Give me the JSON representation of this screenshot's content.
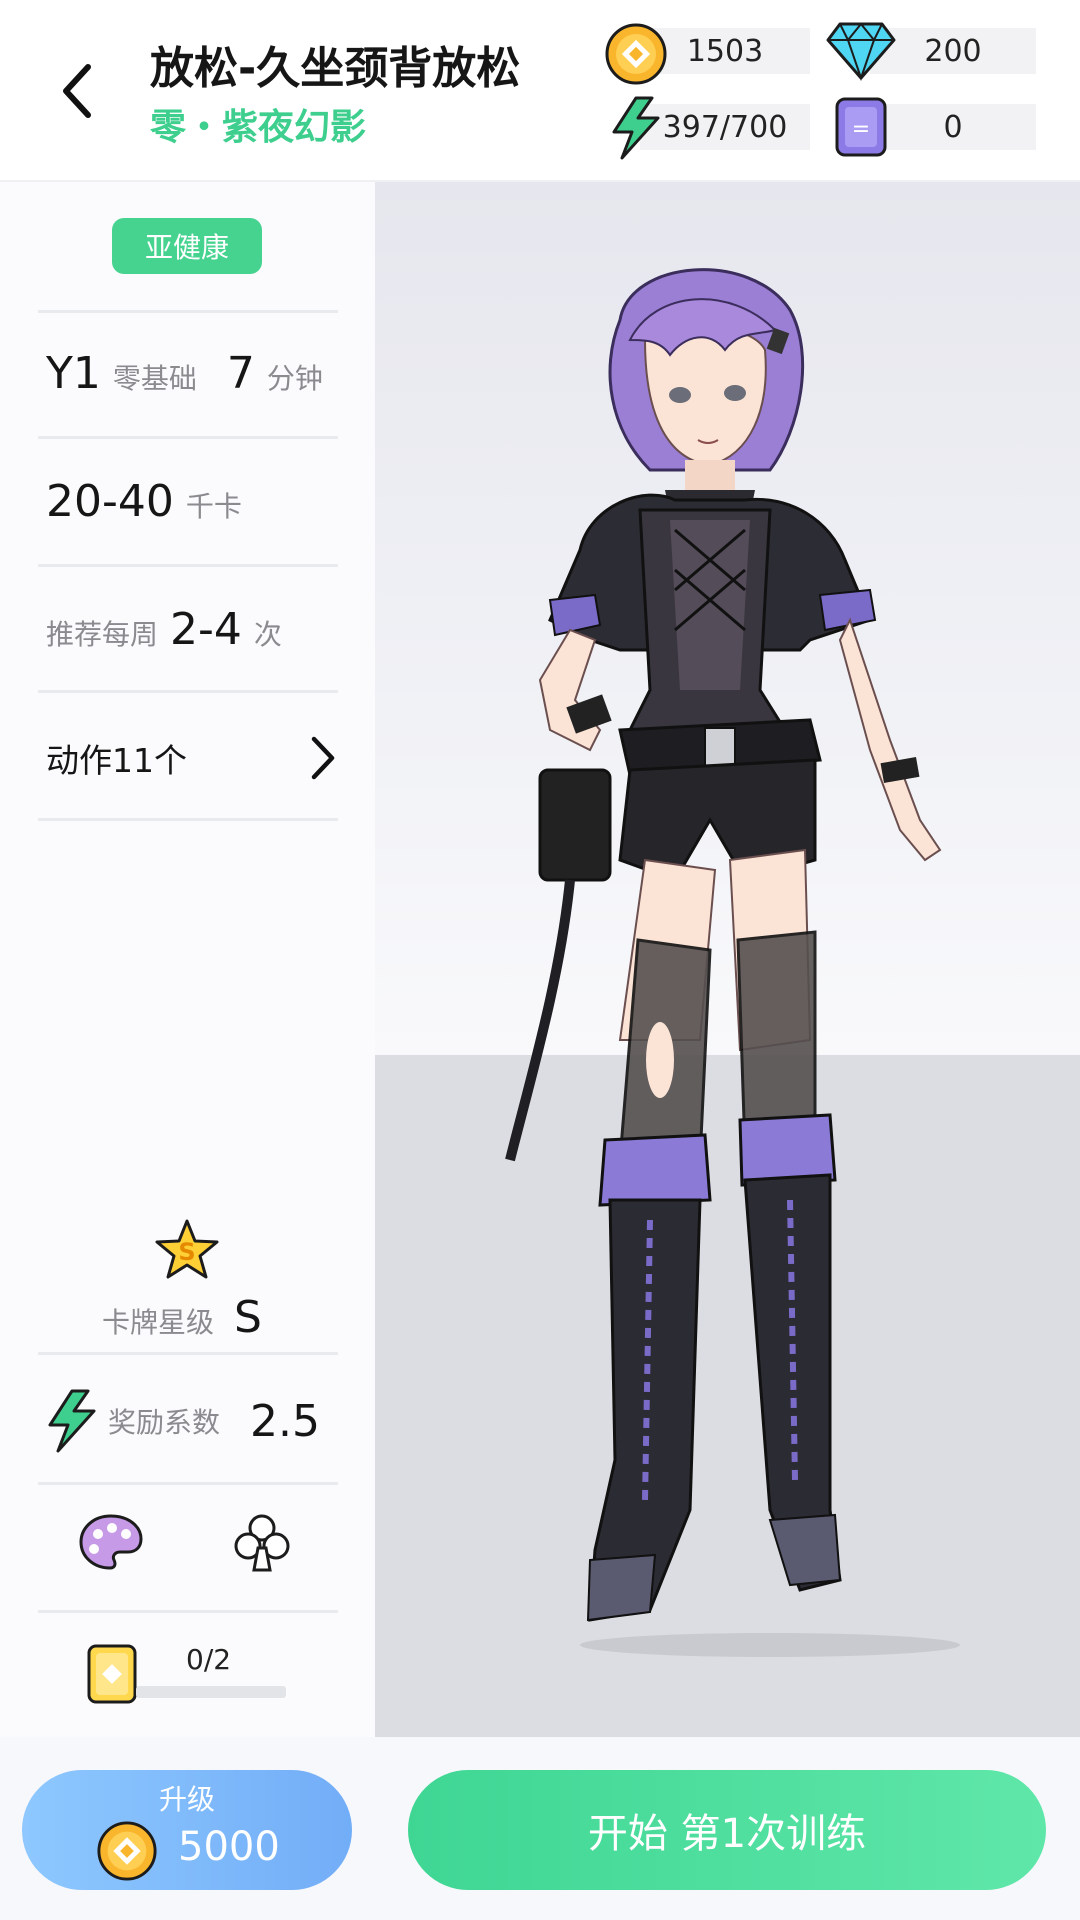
{
  "header": {
    "title": "放松-久坐颈背放松",
    "subtitle": "零・紫夜幻影"
  },
  "resources": {
    "coins": "1503",
    "diamonds": "200",
    "energy": "397/700",
    "tickets": "0"
  },
  "info": {
    "status": "亚健康",
    "level_code": "Y1",
    "level_name": "零基础",
    "duration_value": "7",
    "duration_unit": "分钟",
    "calories_value": "20-40",
    "calories_unit": "千卡",
    "freq_prefix": "推荐每周",
    "freq_value": "2-4",
    "freq_unit": "次",
    "actions_label": "动作11个"
  },
  "card": {
    "star_label": "卡牌星级",
    "star_value": "S",
    "star_badge": "S",
    "reward_label": "奖励系数",
    "reward_value": "2.5",
    "count": "0/2",
    "progress": 0
  },
  "bottom": {
    "upgrade_label": "升级",
    "upgrade_cost": "5000",
    "start_label": "开始 第1次训练"
  },
  "icons": {
    "back": "chevron-left-icon",
    "coin": "coin-icon",
    "diamond": "diamond-icon",
    "energy": "lightning-icon",
    "ticket": "ticket-icon",
    "star": "star-icon",
    "palette": "palette-icon",
    "club": "club-icon",
    "card": "card-icon"
  },
  "colors": {
    "accent_green": "#3ecf8e",
    "status_green": "#45d38f",
    "upgrade_blue": "#7fbaf8",
    "coin_orange": "#f6a623"
  }
}
